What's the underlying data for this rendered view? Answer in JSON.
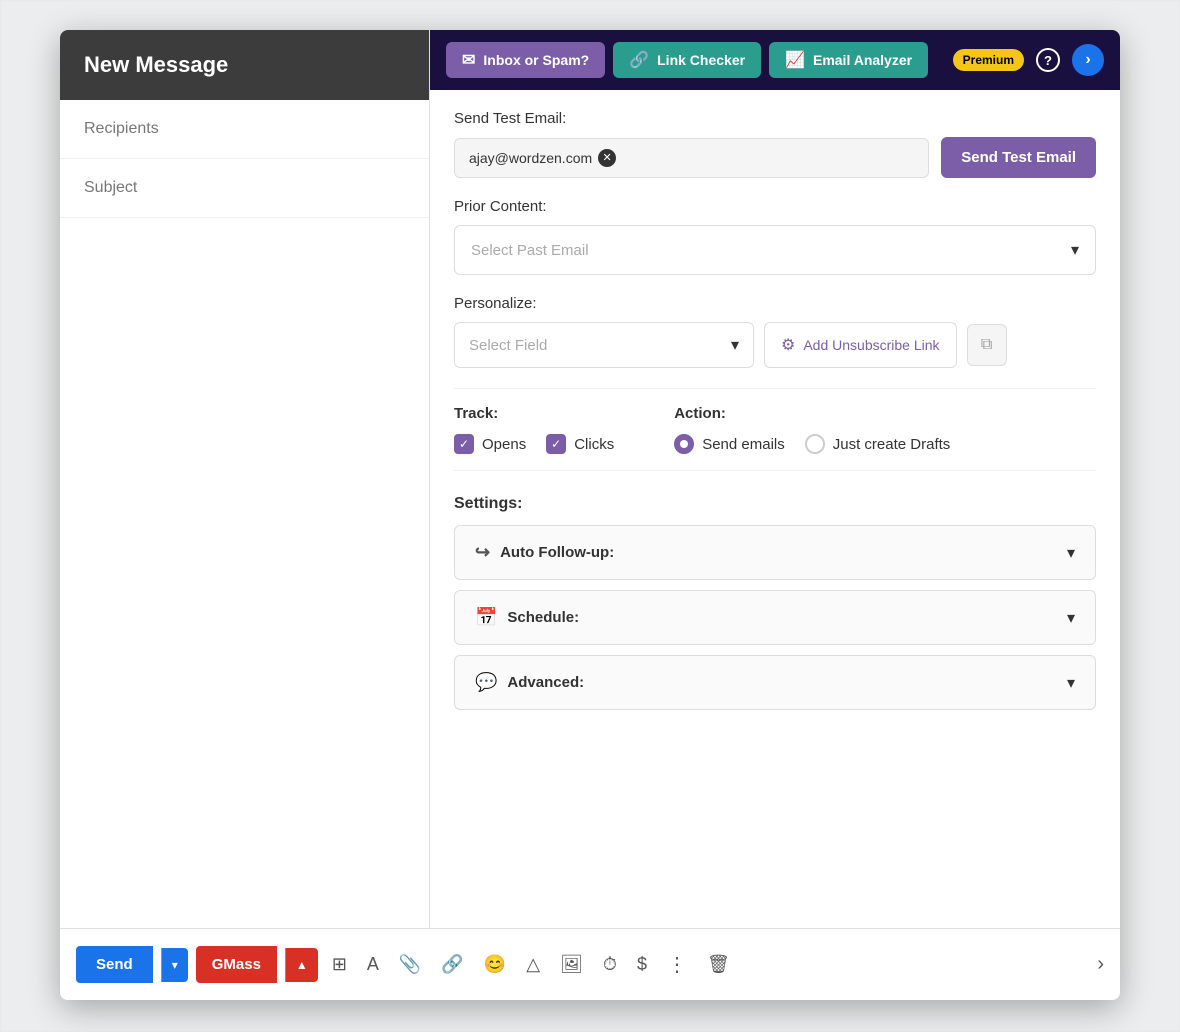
{
  "sidebar": {
    "header": "New Message",
    "items": [
      {
        "label": "Recipients"
      },
      {
        "label": "Subject"
      }
    ]
  },
  "topnav": {
    "premium_label": "Premium",
    "help_icon": "?",
    "tabs": [
      {
        "id": "inbox-spam",
        "label": "Inbox or Spam?",
        "icon": "✉"
      },
      {
        "id": "link-checker",
        "label": "Link Checker",
        "icon": "🔗"
      },
      {
        "id": "email-analyzer",
        "label": "Email Analyzer",
        "icon": "📈"
      }
    ]
  },
  "send_test": {
    "label": "Send Test Email:",
    "email": "ajay@wordzen.com",
    "button_label": "Send Test Email"
  },
  "prior_content": {
    "label": "Prior Content:",
    "placeholder": "Select Past Email"
  },
  "personalize": {
    "label": "Personalize:",
    "field_placeholder": "Select Field",
    "unsubscribe_label": "Add Unsubscribe Link"
  },
  "track": {
    "title": "Track:",
    "options": [
      {
        "label": "Opens",
        "checked": true
      },
      {
        "label": "Clicks",
        "checked": true
      }
    ]
  },
  "action": {
    "title": "Action:",
    "options": [
      {
        "label": "Send emails",
        "selected": true
      },
      {
        "label": "Just create Drafts",
        "selected": false
      }
    ]
  },
  "settings": {
    "title": "Settings:",
    "items": [
      {
        "label": "Auto Follow-up:",
        "icon": "↪"
      },
      {
        "label": "Schedule:",
        "icon": "📅"
      },
      {
        "label": "Advanced:",
        "icon": "💬"
      }
    ]
  },
  "toolbar": {
    "send_label": "Send",
    "gmass_label": "GMass",
    "icons": [
      "⊞",
      "A",
      "📎",
      "🔗",
      "😊",
      "△",
      "🖼",
      "⏱",
      "$",
      "⋮",
      "🗑"
    ]
  }
}
